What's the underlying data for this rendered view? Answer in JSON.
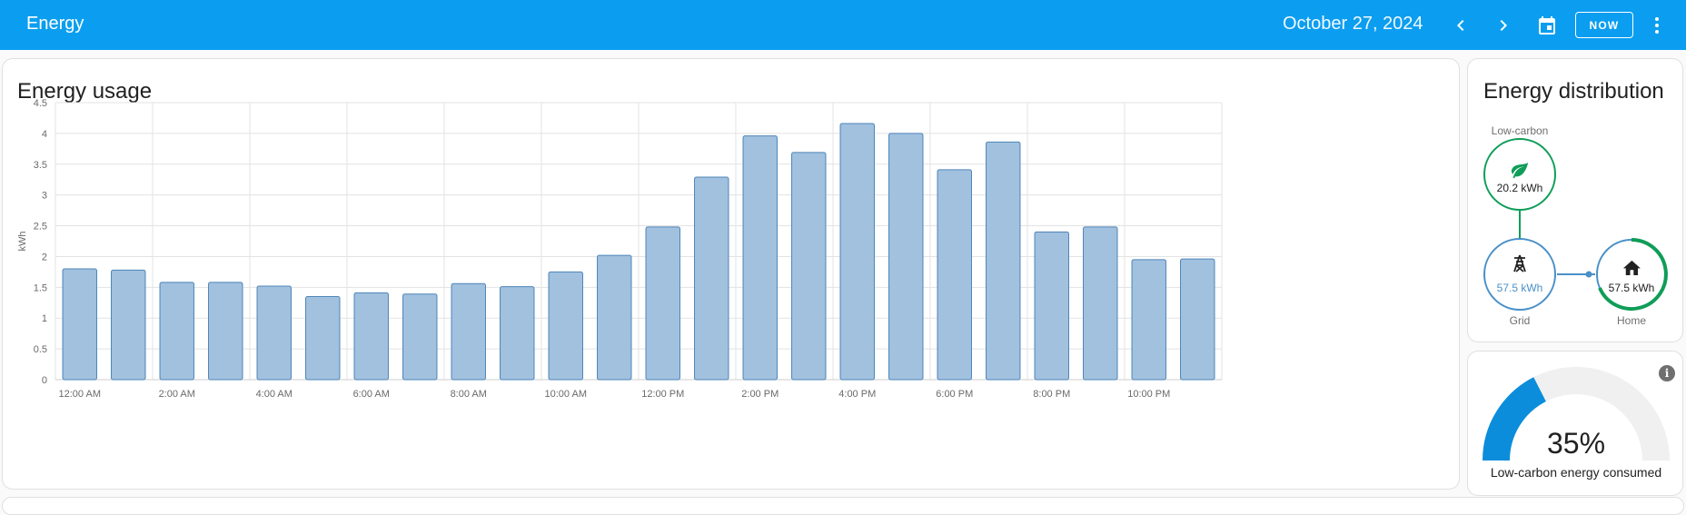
{
  "header": {
    "title": "Energy",
    "date": "October 27, 2024",
    "now_label": "NOW"
  },
  "usage_card": {
    "title": "Energy usage"
  },
  "chart_data": {
    "type": "bar",
    "title": "Energy usage",
    "ylabel": "kWh",
    "xlabel": "",
    "ylim": [
      0,
      4.5
    ],
    "yticks": [
      "0",
      "0.5",
      "1",
      "1.5",
      "2",
      "2.5",
      "3",
      "3.5",
      "4",
      "4.5"
    ],
    "xtick_labels": [
      "12:00 AM",
      "2:00 AM",
      "4:00 AM",
      "6:00 AM",
      "8:00 AM",
      "10:00 AM",
      "12:00 PM",
      "2:00 PM",
      "4:00 PM",
      "6:00 PM",
      "8:00 PM",
      "10:00 PM"
    ],
    "categories": [
      "12:00 AM",
      "1:00 AM",
      "2:00 AM",
      "3:00 AM",
      "4:00 AM",
      "5:00 AM",
      "6:00 AM",
      "7:00 AM",
      "8:00 AM",
      "9:00 AM",
      "10:00 AM",
      "11:00 AM",
      "12:00 PM",
      "1:00 PM",
      "2:00 PM",
      "3:00 PM",
      "4:00 PM",
      "5:00 PM",
      "6:00 PM",
      "7:00 PM",
      "8:00 PM",
      "9:00 PM",
      "10:00 PM",
      "11:00 PM"
    ],
    "values": [
      1.8,
      1.78,
      1.58,
      1.58,
      1.52,
      1.35,
      1.41,
      1.39,
      1.56,
      1.51,
      1.75,
      2.02,
      2.48,
      3.29,
      3.96,
      3.69,
      4.16,
      4.0,
      3.41,
      3.86,
      2.4,
      2.48,
      1.95,
      1.96
    ],
    "grid": true,
    "colors": {
      "fill": "#a1c1df",
      "stroke": "#4e85b8"
    }
  },
  "distribution": {
    "title": "Energy distribution",
    "low_carbon": {
      "label": "Low-carbon",
      "value": "20.2 kWh",
      "icon": "leaf-icon",
      "color": "#0f9d58"
    },
    "grid": {
      "label": "Grid",
      "value": "57.5 kWh",
      "icon": "transmission-tower-icon",
      "color": "#4a90c8"
    },
    "home": {
      "label": "Home",
      "value": "57.5 kWh",
      "icon": "home-icon",
      "color": "#0f9d58"
    }
  },
  "gauge_card": {
    "value": 35,
    "value_label": "35%",
    "label": "Low-carbon energy consumed",
    "color": "#0b8ddb"
  }
}
